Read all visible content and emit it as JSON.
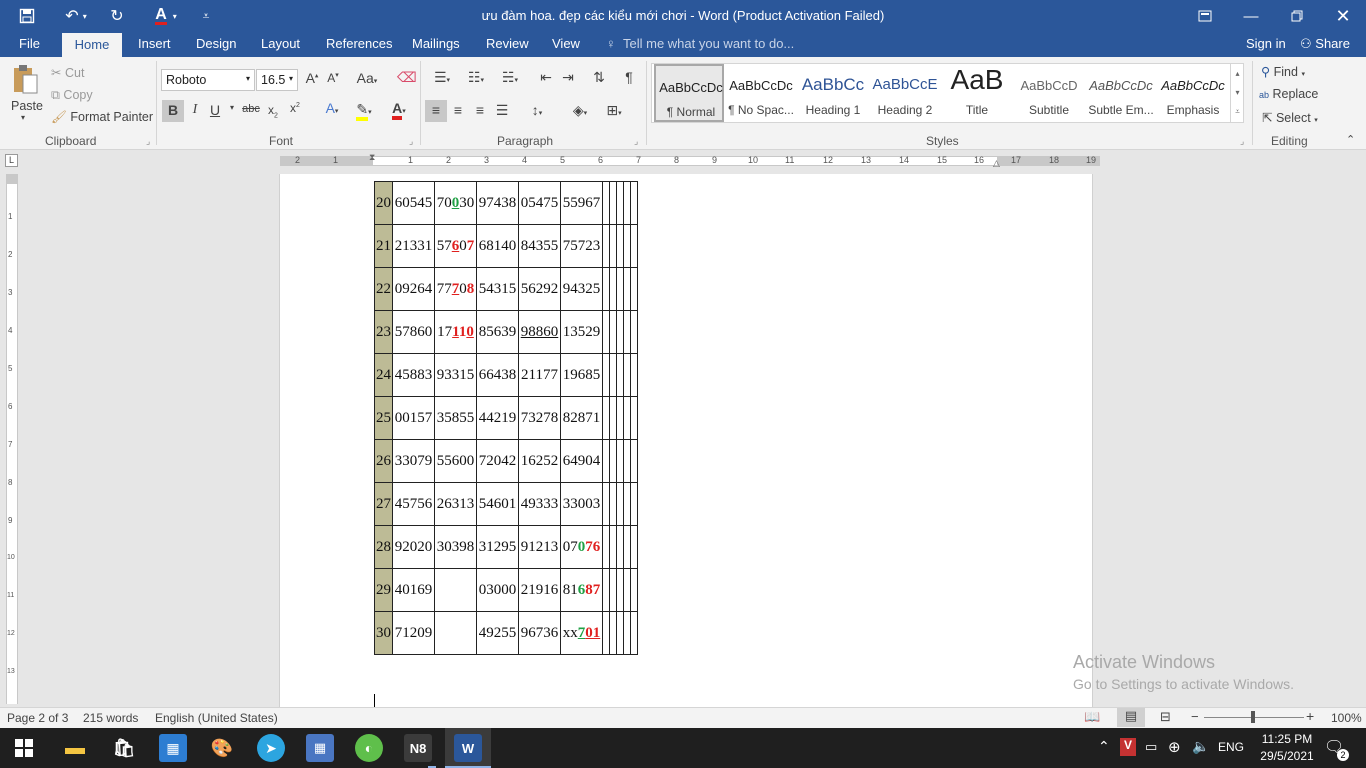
{
  "titlebar": {
    "title": "ưu đàm hoa. đẹp các kiểu mới chơi - Word (Product Activation Failed)"
  },
  "menubar": {
    "tabs": [
      "File",
      "Home",
      "Insert",
      "Design",
      "Layout",
      "References",
      "Mailings",
      "Review",
      "View"
    ],
    "tell_me": "Tell me what you want to do...",
    "sign_in": "Sign in",
    "share": "Share"
  },
  "ribbon": {
    "clipboard": {
      "paste": "Paste",
      "cut": "Cut",
      "copy": "Copy",
      "format_painter": "Format Painter",
      "label": "Clipboard"
    },
    "font": {
      "name": "Roboto",
      "size": "16.5",
      "label": "Font"
    },
    "paragraph": {
      "label": "Paragraph"
    },
    "styles": {
      "label": "Styles",
      "items": [
        {
          "preview": "AaBbCcDc",
          "name": "¶ Normal"
        },
        {
          "preview": "AaBbCcDc",
          "name": "¶ No Spac..."
        },
        {
          "preview": "AaBbCc",
          "name": "Heading 1"
        },
        {
          "preview": "AaBbCcE",
          "name": "Heading 2"
        },
        {
          "preview": "AaB",
          "name": "Title"
        },
        {
          "preview": "AaBbCcD",
          "name": "Subtitle"
        },
        {
          "preview": "AaBbCcDc",
          "name": "Subtle Em..."
        },
        {
          "preview": "AaBbCcDc",
          "name": "Emphasis"
        }
      ]
    },
    "editing": {
      "find": "Find",
      "replace": "Replace",
      "select": "Select",
      "label": "Editing"
    }
  },
  "ruler": {
    "numbers": [
      "2",
      "1",
      "1",
      "2",
      "3",
      "4",
      "5",
      "6",
      "7",
      "8",
      "9",
      "10",
      "11",
      "12",
      "13",
      "14",
      "15",
      "16",
      "17",
      "18",
      "19"
    ]
  },
  "vruler": {
    "numbers": [
      "1",
      "2",
      "3",
      "4",
      "5",
      "6",
      "7",
      "8",
      "9",
      "10",
      "11",
      "12",
      "13"
    ]
  },
  "document": {
    "rows": [
      {
        "n": "20",
        "cells": [
          [
            {
              "t": "60545"
            }
          ],
          [
            {
              "t": "70"
            },
            {
              "t": "0",
              "s": "g u"
            },
            {
              "t": "30"
            }
          ],
          [
            {
              "t": "97438"
            }
          ],
          [
            {
              "t": "05475"
            }
          ],
          [
            {
              "t": "55967"
            }
          ]
        ]
      },
      {
        "n": "21",
        "cells": [
          [
            {
              "t": "21331"
            }
          ],
          [
            {
              "t": "57"
            },
            {
              "t": "6",
              "s": "r u"
            },
            {
              "t": "0"
            },
            {
              "t": "7",
              "s": "r"
            }
          ],
          [
            {
              "t": "68140"
            }
          ],
          [
            {
              "t": "84355"
            }
          ],
          [
            {
              "t": "75723"
            }
          ]
        ]
      },
      {
        "n": "22",
        "cells": [
          [
            {
              "t": "09264"
            }
          ],
          [
            {
              "t": "77"
            },
            {
              "t": "7",
              "s": "r u"
            },
            {
              "t": "0"
            },
            {
              "t": "8",
              "s": "r"
            }
          ],
          [
            {
              "t": "54315"
            }
          ],
          [
            {
              "t": "56292"
            }
          ],
          [
            {
              "t": "94325"
            }
          ]
        ]
      },
      {
        "n": "23",
        "cells": [
          [
            {
              "t": "57860"
            }
          ],
          [
            {
              "t": "17"
            },
            {
              "t": "1",
              "s": "r u"
            },
            {
              "t": "1",
              "s": "r"
            },
            {
              "t": "0",
              "s": "r u"
            }
          ],
          [
            {
              "t": "85639"
            }
          ],
          [
            {
              "t": "98860",
              "s": "u"
            }
          ],
          [
            {
              "t": "13529"
            }
          ]
        ]
      },
      {
        "n": "24",
        "cells": [
          [
            {
              "t": "45883"
            }
          ],
          [
            {
              "t": "93315"
            }
          ],
          [
            {
              "t": "66438"
            }
          ],
          [
            {
              "t": "21177"
            }
          ],
          [
            {
              "t": "19685"
            }
          ]
        ]
      },
      {
        "n": "25",
        "cells": [
          [
            {
              "t": "00157"
            }
          ],
          [
            {
              "t": "35855"
            }
          ],
          [
            {
              "t": "44219"
            }
          ],
          [
            {
              "t": "73278"
            }
          ],
          [
            {
              "t": "82871"
            }
          ]
        ]
      },
      {
        "n": "26",
        "cells": [
          [
            {
              "t": "33079"
            }
          ],
          [
            {
              "t": "55600"
            }
          ],
          [
            {
              "t": "72042"
            }
          ],
          [
            {
              "t": "16252"
            }
          ],
          [
            {
              "t": "64904"
            }
          ]
        ]
      },
      {
        "n": "27",
        "cells": [
          [
            {
              "t": "45756"
            }
          ],
          [
            {
              "t": "26313"
            }
          ],
          [
            {
              "t": "54601"
            }
          ],
          [
            {
              "t": "49333"
            }
          ],
          [
            {
              "t": "33003"
            }
          ]
        ]
      },
      {
        "n": "28",
        "cells": [
          [
            {
              "t": "92020"
            }
          ],
          [
            {
              "t": "30398"
            }
          ],
          [
            {
              "t": "31295"
            }
          ],
          [
            {
              "t": "91213"
            }
          ],
          [
            {
              "t": "07"
            },
            {
              "t": "0",
              "s": "g"
            },
            {
              "t": "76",
              "s": "r"
            }
          ]
        ]
      },
      {
        "n": "29",
        "cells": [
          [
            {
              "t": "40169"
            }
          ],
          [],
          [
            {
              "t": "03000"
            }
          ],
          [
            {
              "t": "21916"
            }
          ],
          [
            {
              "t": "81"
            },
            {
              "t": "6",
              "s": "g"
            },
            {
              "t": "87",
              "s": "r"
            }
          ]
        ]
      },
      {
        "n": "30",
        "cells": [
          [
            {
              "t": "71209"
            }
          ],
          [],
          [
            {
              "t": "49255"
            }
          ],
          [
            {
              "t": "96736"
            }
          ],
          [
            {
              "t": "xx"
            },
            {
              "t": "7",
              "s": "g u"
            },
            {
              "t": "01",
              "s": "r u"
            }
          ]
        ]
      }
    ]
  },
  "watermark": {
    "line1": "Activate Windows",
    "line2": "Go to Settings to activate Windows."
  },
  "statusbar": {
    "page": "Page 2 of 3",
    "words": "215 words",
    "language": "English (United States)",
    "zoom": "100%"
  },
  "taskbar": {
    "lang": "ENG",
    "time": "11:25 PM",
    "date": "29/5/2021",
    "notifications": "2",
    "n8_label": "N8"
  }
}
